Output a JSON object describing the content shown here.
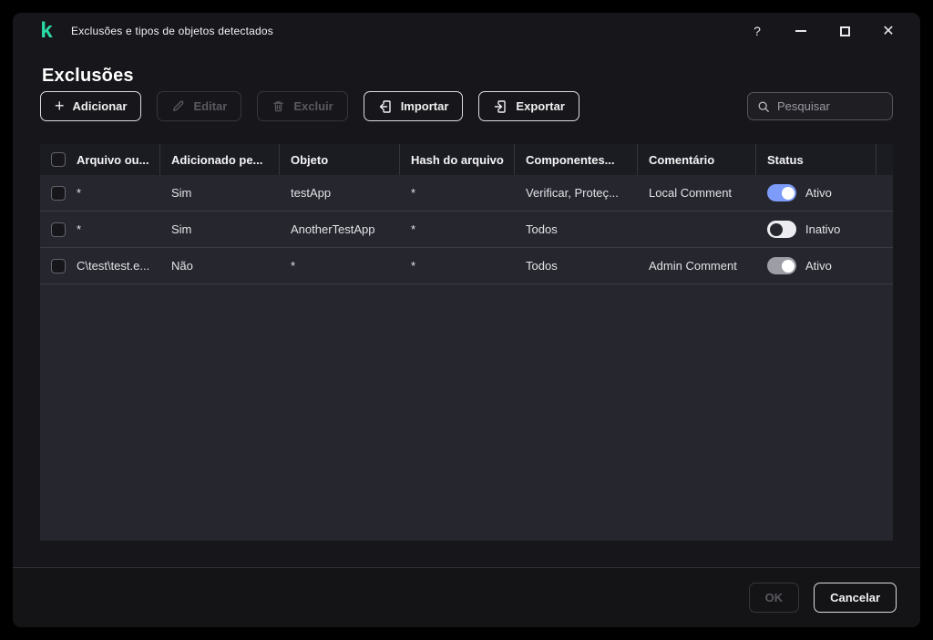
{
  "window": {
    "title": "Exclusões e tipos de objetos detectados",
    "controls": {
      "help_glyph": "?"
    }
  },
  "page": {
    "heading": "Exclusões"
  },
  "toolbar": {
    "add_label": "Adicionar",
    "edit_label": "Editar",
    "delete_label": "Excluir",
    "import_label": "Importar",
    "export_label": "Exportar"
  },
  "search": {
    "placeholder": "Pesquisar"
  },
  "table": {
    "headers": {
      "file": "Arquivo ou...",
      "added_by": "Adicionado pe...",
      "object": "Objeto",
      "hash": "Hash do arquivo",
      "components": "Componentes...",
      "comment": "Comentário",
      "status": "Status"
    },
    "rows": [
      {
        "file": "*",
        "added_by": "Sim",
        "object": "testApp",
        "hash": "*",
        "components": "Verificar, Proteç...",
        "comment": "Local Comment",
        "status_label": "Ativo",
        "status_state": "on"
      },
      {
        "file": "*",
        "added_by": "Sim",
        "object": "AnotherTestApp",
        "hash": "*",
        "components": "Todos",
        "comment": "",
        "status_label": "Inativo",
        "status_state": "off"
      },
      {
        "file": "C\\test\\test.e...",
        "added_by": "Não",
        "object": "*",
        "hash": "*",
        "components": "Todos",
        "comment": "Admin Comment",
        "status_label": "Ativo",
        "status_state": "on-gray"
      }
    ]
  },
  "footer": {
    "ok_label": "OK",
    "cancel_label": "Cancelar"
  },
  "colors": {
    "brand_green": "#2bd9a6",
    "toggle_on": "#7d9bf8",
    "toggle_off_track": "#ececf1",
    "toggle_disabled": "#9d9da5",
    "panel_bg": "#26262e",
    "window_bg": "#17171b"
  }
}
